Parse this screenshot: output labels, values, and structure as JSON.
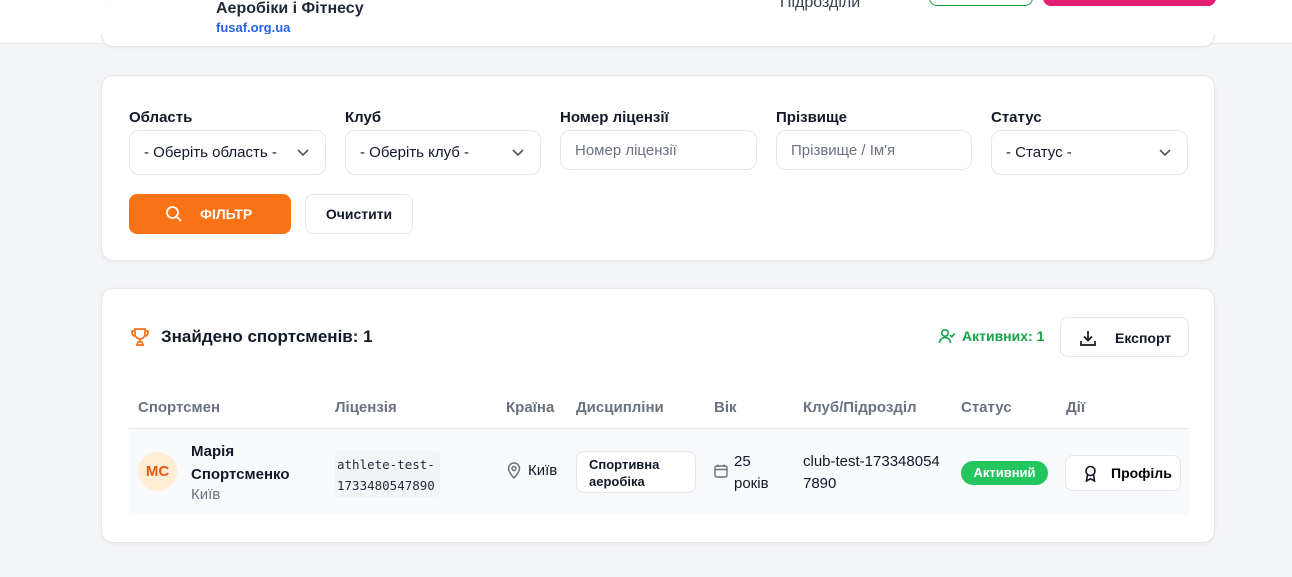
{
  "header": {
    "org_name": "Аеробіки і Фітнесу",
    "org_url": "fusaf.org.ua",
    "nav_item": "Підрозділи"
  },
  "filters": {
    "region": {
      "label": "Область",
      "value": "- Оберіть область -"
    },
    "club": {
      "label": "Клуб",
      "value": "- Оберіть клуб -"
    },
    "license": {
      "label": "Номер ліцензії",
      "placeholder": "Номер ліцензії"
    },
    "surname": {
      "label": "Прізвище",
      "placeholder": "Прізвище / Ім'я"
    },
    "status": {
      "label": "Статус",
      "value": "- Статус -"
    },
    "filter_button": "ФІЛЬТР",
    "clear_button": "Очистити"
  },
  "results": {
    "found_label": "Знайдено спортсменів: 1",
    "active_label": "Активних: 1",
    "export_button": "Експорт",
    "columns": [
      "Спортсмен",
      "Ліцензія",
      "Країна",
      "Дисципліни",
      "Вік",
      "Клуб/Підрозділ",
      "Статус",
      "Дії"
    ],
    "rows": [
      {
        "initials": "МС",
        "name": "Марія Спортсменко",
        "city": "Київ",
        "license": "athlete-test-1733480547890",
        "country": "Київ",
        "discipline": "Спортивна аеробіка",
        "age": "25 років",
        "club": "club-test-1733480547890",
        "status": "Активний",
        "action": "Профіль"
      }
    ]
  },
  "colors": {
    "accent_orange": "#f97316",
    "status_green": "#22c55e",
    "active_text": "#16a34a",
    "brand_blue": "#2563eb",
    "brand_pink": "#e11d74"
  }
}
